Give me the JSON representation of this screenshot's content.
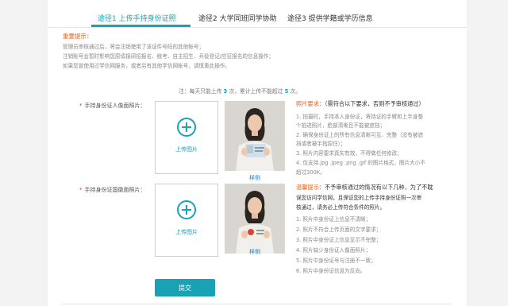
{
  "tabs": [
    {
      "label": "途径1 上传手持身份证照",
      "active": true
    },
    {
      "label": "途径2 大学同班同学协助",
      "active": false
    },
    {
      "label": "途径3 提供学籍或学历信息",
      "active": false
    }
  ],
  "notice": {
    "title": "重要提示：",
    "lines": [
      "管理员审核通过后，将会注销使用了该证件号码的其他账号；",
      "注销账号会暂时影响您原填报研招报名、统考、自主招生、兵役登记/应征报名的信息操作；",
      "如果您曾使用过学信网服务，或者另有其他学信网账号，请慎重此操作。"
    ]
  },
  "limit": {
    "prefix": "注：每天只能上传",
    "daily": "3",
    "middle": "次，累计上传不能超过",
    "total": "5",
    "suffix": "次。"
  },
  "fields": [
    {
      "star": "*",
      "label": "手持身份证人像面照片："
    },
    {
      "star": "*",
      "label": "手持身份证国徽面照片："
    }
  ],
  "upload_label": "上传图片",
  "sample_label": "样例",
  "requirements": {
    "head_hl": "照片要求：",
    "head_rest": "（需符合以下要求，否则不予审核通过）",
    "lines": [
      "1. 拍摄时，手持本人身份证，将持证的手臂和上半身整",
      "个拍进照片，脸部清晰且不能被遮挡；",
      "2. 确保身份证上的所有信息清晰可见、完整（没有被遮",
      "挡或者被手指捏住）；",
      "3. 照片内容要求真实有效，不得做任何修改；",
      "4. 仅支持.jpg .jpeg .png .gif 的图片格式，图片大小不",
      "超过300K。"
    ]
  },
  "warnings": {
    "head_hl": "温馨提示：",
    "head_rest": "不予审核通过的情况有以下几种，为了不耽",
    "lines_head": [
      "误您访问学信网，且保证您的上传手持身份证照一次审",
      "核通过，请务必上传符合条件的照片。"
    ],
    "lines": [
      "1. 照片中身份证上信息不清晰；",
      "2. 照片不符合上传页面的文字要求；",
      "3. 照片中身份证上信息显示不完整；",
      "4. 照片缺少身份证人像面照片；",
      "5. 照片中身份证号与注册不一致；",
      "6. 照片中身份证信息为反向。"
    ]
  },
  "submit_label": "提交",
  "colors": {
    "accent": "#1aa1b4",
    "warn": "#e8641f",
    "star": "#e23b2e",
    "link": "#1a7fd0"
  }
}
